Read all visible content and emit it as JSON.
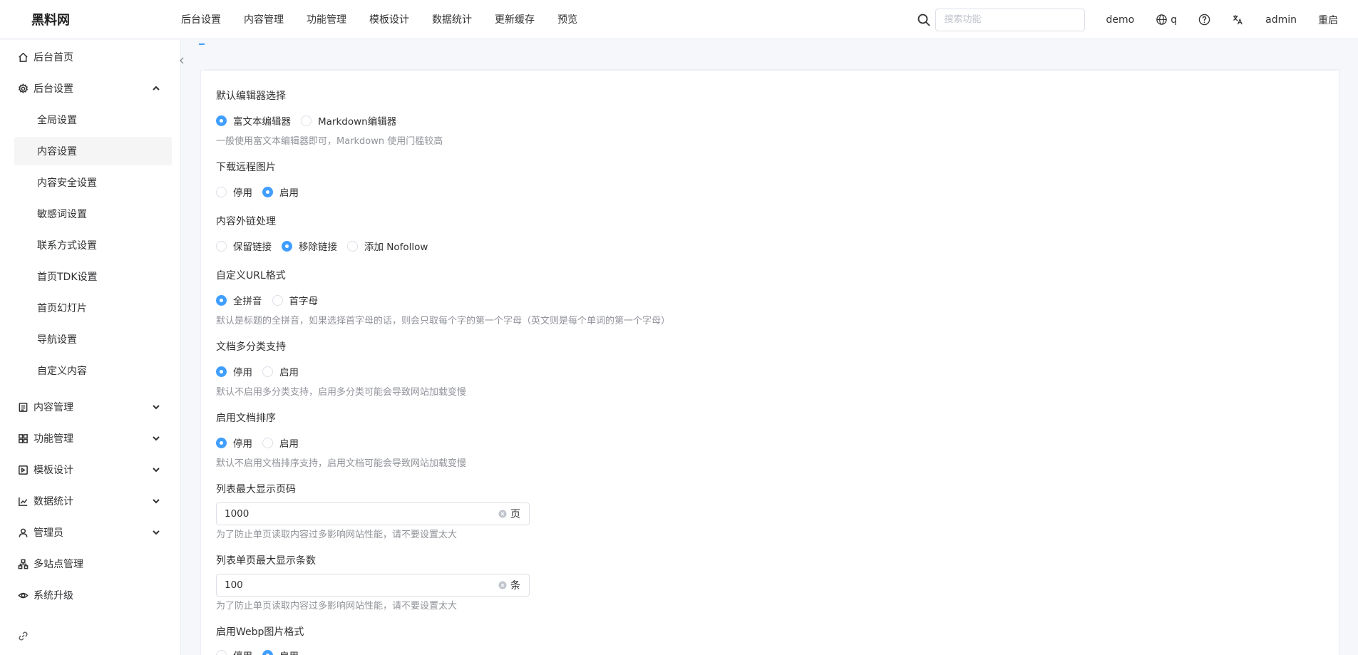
{
  "header": {
    "brand": "黑料网",
    "nav": [
      "后台设置",
      "内容管理",
      "功能管理",
      "模板设计",
      "数据统计",
      "更新缓存",
      "预览"
    ],
    "search_placeholder": "搜索功能",
    "user_site": "demo",
    "lang": "q",
    "account": "admin",
    "restart": "重启"
  },
  "sidebar": {
    "items": [
      {
        "label": "后台首页",
        "icon": "home-icon"
      },
      {
        "label": "后台设置",
        "icon": "gear-icon",
        "expanded": true
      },
      {
        "label": "内容管理",
        "icon": "document-icon"
      },
      {
        "label": "功能管理",
        "icon": "grid-icon"
      },
      {
        "label": "模板设计",
        "icon": "template-icon"
      },
      {
        "label": "数据统计",
        "icon": "chart-icon"
      },
      {
        "label": "管理员",
        "icon": "user-icon"
      },
      {
        "label": "多站点管理",
        "icon": "sites-icon"
      },
      {
        "label": "系统升级",
        "icon": "upgrade-icon"
      }
    ],
    "sub_items": [
      "全局设置",
      "内容设置",
      "内容安全设置",
      "敏感词设置",
      "联系方式设置",
      "首页TDK设置",
      "首页幻灯片",
      "导航设置",
      "自定义内容"
    ],
    "active_sub": "内容设置"
  },
  "form": {
    "editor": {
      "label": "默认编辑器选择",
      "options": [
        "富文本编辑器",
        "Markdown编辑器"
      ],
      "selected": "富文本编辑器",
      "hint": "一般使用富文本编辑器即可，Markdown 使用门槛较高"
    },
    "remote_image": {
      "label": "下载远程图片",
      "options": [
        "停用",
        "启用"
      ],
      "selected": "启用"
    },
    "outlink": {
      "label": "内容外链处理",
      "options": [
        "保留链接",
        "移除链接",
        "添加 Nofollow"
      ],
      "selected": "移除链接"
    },
    "url_format": {
      "label": "自定义URL格式",
      "options": [
        "全拼音",
        "首字母"
      ],
      "selected": "全拼音",
      "hint": "默认是标题的全拼音，如果选择首字母的话，则会只取每个字的第一个字母（英文则是每个单词的第一个字母）"
    },
    "multi_category": {
      "label": "文档多分类支持",
      "options": [
        "停用",
        "启用"
      ],
      "selected": "停用",
      "hint": "默认不启用多分类支持，启用多分类可能会导致网站加载变慢"
    },
    "doc_sort": {
      "label": "启用文档排序",
      "options": [
        "停用",
        "启用"
      ],
      "selected": "停用",
      "hint": "默认不启用文档排序支持，启用文档可能会导致网站加载变慢"
    },
    "max_page": {
      "label": "列表最大显示页码",
      "value": "1000",
      "suffix": "页",
      "hint": "为了防止单页读取内容过多影响网站性能，请不要设置太大"
    },
    "max_per_page": {
      "label": "列表单页最大显示条数",
      "value": "100",
      "suffix": "条",
      "hint": "为了防止单页读取内容过多影响网站性能，请不要设置太大"
    },
    "webp": {
      "label": "启用Webp图片格式",
      "options": [
        "停用",
        "启用"
      ],
      "selected": "启用"
    }
  },
  "colors": {
    "primary": "#409eff",
    "text": "#303133",
    "hint": "#909399",
    "border": "#dcdfe6"
  }
}
